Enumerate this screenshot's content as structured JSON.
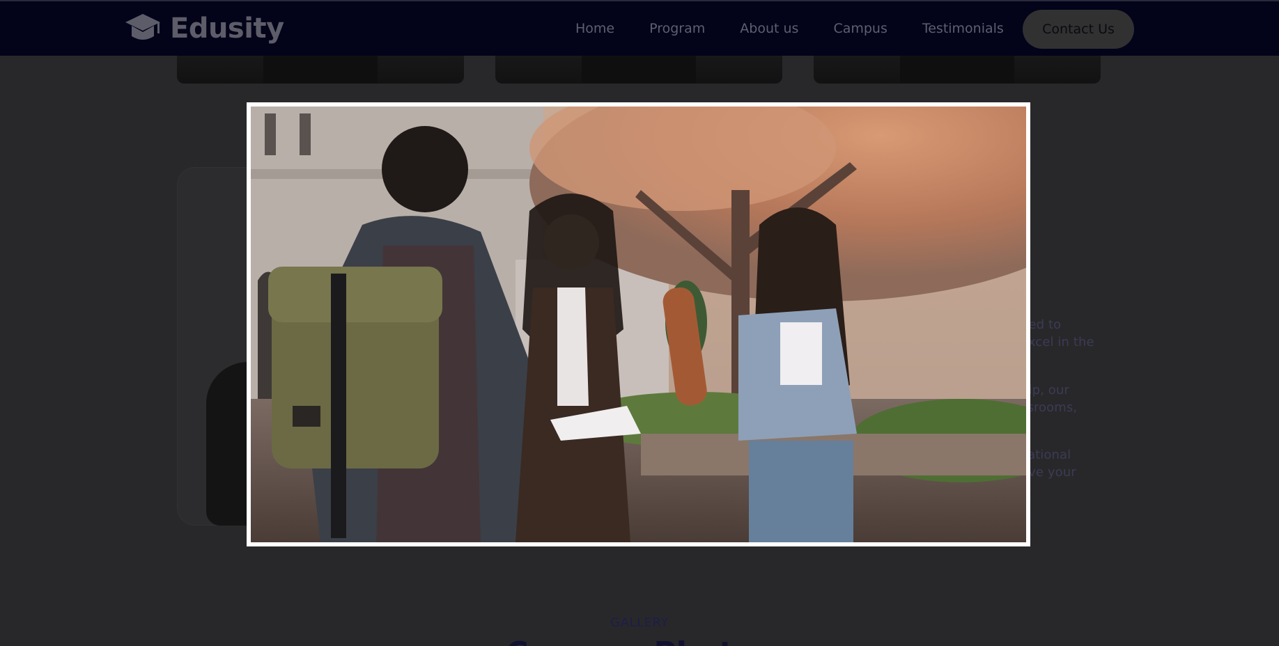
{
  "brand": {
    "name": "Edusity",
    "icon": "graduation-cap-icon"
  },
  "nav": {
    "links": [
      "Home",
      "Program",
      "About us",
      "Campus",
      "Testimonials"
    ],
    "contact_label": "Contact Us"
  },
  "about": {
    "text_fragments": [
      "ned to",
      "excel in the",
      "hip, our",
      "ssrooms,",
      "cational",
      "eve your"
    ]
  },
  "gallery": {
    "label": "GALLERY",
    "title": "Campus Photos"
  },
  "video_modal": {
    "content": "campus students video"
  },
  "colors": {
    "navbar_bg": "#03031a",
    "overlay_page_bg": "#28282a",
    "modal_border": "#ffffff"
  }
}
